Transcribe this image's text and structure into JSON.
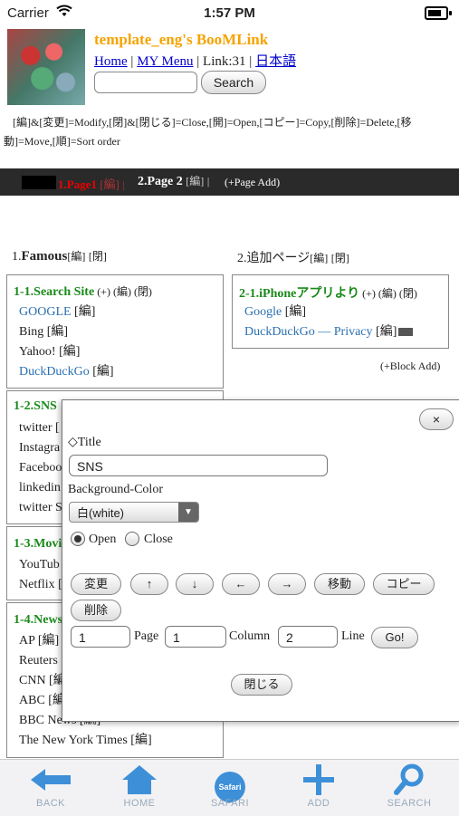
{
  "status_bar": {
    "carrier": "Carrier",
    "time": "1:57 PM"
  },
  "header": {
    "site_title": "template_eng's BooMLink",
    "nav_home": "Home",
    "nav_sep1": " | ",
    "nav_my_menu": "MY Menu",
    "nav_link_count": " | Link:31 | ",
    "nav_japanese": "日本語",
    "search_button": "Search",
    "legend": "[編]&[変更]=Modify,[閉]&[閉じる]=Close,[開]=Open,[コピー]=Copy,[削除]=Delete,[移動]=Move,[順]=Sort order"
  },
  "pages": {
    "tab1_label": "1.Page1",
    "tab1_edit": "[編]",
    "tab_sep": "|",
    "tab2_label": "2.Page 2",
    "tab2_edit": "[編]",
    "tab_sep2": "|",
    "add_page": "(+Page Add)"
  },
  "column1": {
    "number": "1.",
    "name": "Famous",
    "edit": "[編]",
    "close": "[閉]",
    "blocks": [
      {
        "title": "1-1.Search Site",
        "controls": " (+) (編) (閉)",
        "links": [
          {
            "text": "GOOGLE",
            "edit": " [編]",
            "color": "#2a6fb0"
          },
          {
            "text": "Bing",
            "edit": " [編]",
            "color": "#222222"
          },
          {
            "text": "Yahoo!",
            "edit": " [編]",
            "color": "#222222"
          },
          {
            "text": "DuckDuckGo",
            "edit": " [編]",
            "color": "#2a6fb0"
          }
        ]
      },
      {
        "title": "1-2.SNS",
        "links": [
          "twitter [",
          "Instagra",
          "Faceboo",
          "linkedin",
          "twitter S"
        ]
      },
      {
        "title": "1-3.Movi",
        "links": [
          "YouTub",
          "Netflix ["
        ]
      },
      {
        "title": "1-4.News",
        "links": [
          "AP [編]",
          "Reuters",
          "CNN [編",
          "ABC [編",
          "BBC News [編]",
          "The New York Times [編]"
        ]
      }
    ]
  },
  "column2": {
    "number": "2.",
    "name": "追加ページ",
    "edit": "[編]",
    "close": "[閉]",
    "block": {
      "title": "2-1.iPhoneアプリより",
      "controls": " (+) (編) (閉)",
      "links": [
        {
          "text": "Google",
          "edit": " [編]"
        },
        {
          "text": "DuckDuckGo — Privacy",
          "edit": " [編]"
        }
      ]
    },
    "block_add": "(+Block Add)"
  },
  "dialog": {
    "close_button": "×",
    "title_label": "◇Title",
    "title_value": "SNS",
    "bg_label": "Background-Color",
    "bg_value": "白(white)",
    "open_label": "Open",
    "close_label": "Close",
    "open_selected": true,
    "btn_modify": "変更",
    "btn_up": "↑",
    "btn_down": "↓",
    "btn_left": "←",
    "btn_right": "→",
    "btn_move": "移動",
    "btn_copy": "コピー",
    "btn_delete": "削除",
    "page_value": "1",
    "page_label": "Page",
    "column_value": "1",
    "column_label": "Column",
    "line_value": "2",
    "line_label": "Line",
    "go_button": "Go!",
    "close_dialog_button": "閉じる"
  },
  "toolbar": {
    "back": "BACK",
    "home": "HOME",
    "safari": "SAFARI",
    "safari_badge": "Safari",
    "add": "ADD",
    "search": "SEARCH"
  },
  "colors": {
    "accent_orange": "#f5a300",
    "link_blue": "#2a6fb0",
    "block_green": "#1a8a1a",
    "active_tab_red": "#ee0000",
    "toolbar_icon_blue": "#3d8fd8"
  }
}
